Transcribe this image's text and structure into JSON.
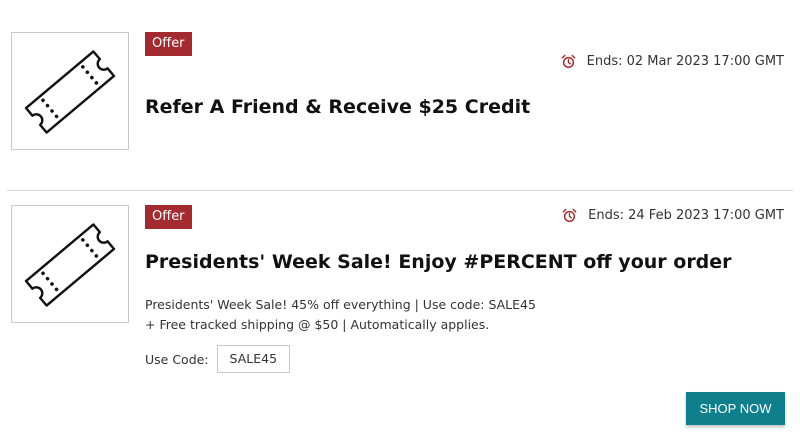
{
  "offers": [
    {
      "badge": "Offer",
      "ends": "Ends: 02 Mar 2023 17:00 GMT",
      "title": "Refer A Friend & Receive $25 Credit",
      "icon": "ticket-icon"
    },
    {
      "badge": "Offer",
      "ends": "Ends: 24 Feb 2023 17:00 GMT",
      "title": "Presidents' Week Sale! Enjoy #PERCENT off your order",
      "description_line1": "Presidents' Week Sale! 45% off everything | Use code: SALE45",
      "description_line2": "+ Free tracked shipping @ $50 | Automatically applies.",
      "code_label": "Use Code:",
      "code": "SALE45",
      "button": "SHOP NOW",
      "icon": "ticket-icon"
    }
  ],
  "colors": {
    "badge": "#a32a2f",
    "alarm": "#a32a2f",
    "button": "#0f7f8c"
  }
}
